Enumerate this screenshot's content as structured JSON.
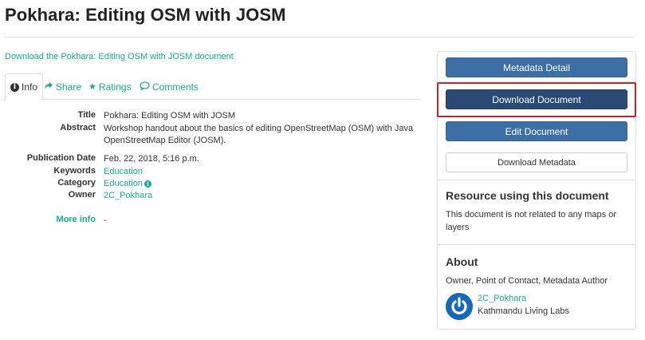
{
  "page": {
    "title": "Pokhara: Editing OSM with JOSM",
    "download_link": "Download the Pokhara: Editing OSM with JOSM document"
  },
  "tabs": [
    {
      "label": "Info",
      "icon": "info-circle-icon",
      "active": true
    },
    {
      "label": "Share",
      "icon": "share-arrow-icon"
    },
    {
      "label": "Ratings",
      "icon": "star-icon"
    },
    {
      "label": "Comments",
      "icon": "speech-bubble-icon"
    }
  ],
  "metadata": {
    "title_label": "Title",
    "title_value": "Pokhara: Editing OSM with JOSM",
    "abstract_label": "Abstract",
    "abstract_value": "Workshop handout about the basics of editing OpenStreetMap (OSM) with Java OpenStreetMap Editor (JOSM).",
    "pubdate_label": "Publication Date",
    "pubdate_value": "Feb. 22, 2018, 5:16 p.m.",
    "keywords_label": "Keywords",
    "keywords_value": "Education",
    "category_label": "Category",
    "category_value": "Education",
    "owner_label": "Owner",
    "owner_value": "2C_Pokhara",
    "more_info_label": "More info",
    "more_info_value": "-"
  },
  "sidebar": {
    "metadata_detail": "Metadata Detail",
    "download_document": "Download Document",
    "edit_document": "Edit Document",
    "download_metadata": "Download Metadata",
    "resource_title": "Resource using this document",
    "resource_text": "This document is not related to any maps or layers",
    "about_title": "About",
    "about_roles": "Owner, Point of Contact, Metadata Author",
    "about_user": "2C_Pokhara",
    "about_org": "Kathmandu Living Labs"
  },
  "colors": {
    "link": "#1aab8e",
    "primary_button": "#3e6ea6",
    "highlighted_button": "#2a4a75",
    "highlight_border": "#c0262c"
  }
}
